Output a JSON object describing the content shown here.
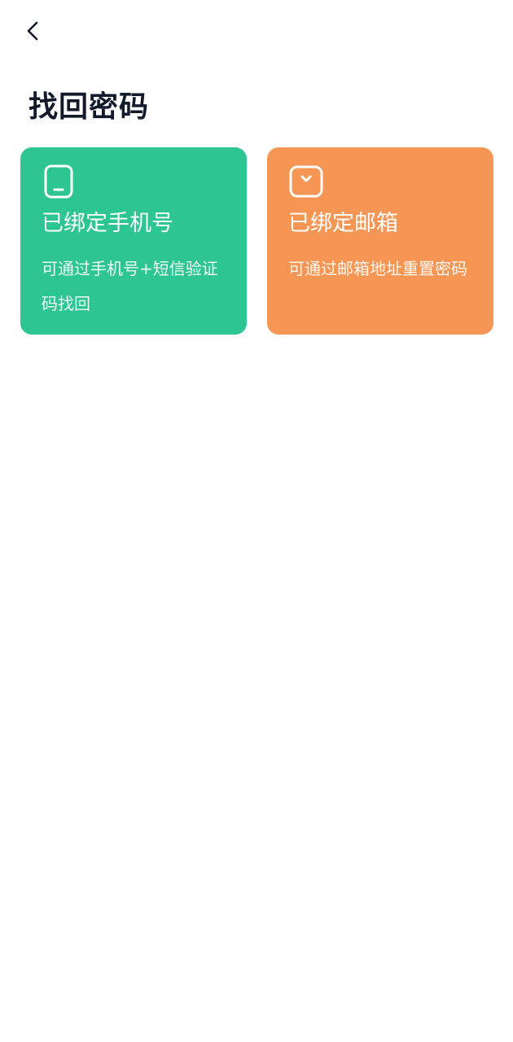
{
  "header": {
    "back_icon": "chevron-left-icon",
    "title": "找回密码"
  },
  "options": [
    {
      "icon": "phone-icon",
      "title": "已绑定手机号",
      "description": "可通过手机号+短信验证码找回",
      "color": "#2dc592"
    },
    {
      "icon": "mailbox-icon",
      "title": "已绑定邮箱",
      "description": "可通过邮箱地址重置密码",
      "color": "#f59654"
    }
  ]
}
